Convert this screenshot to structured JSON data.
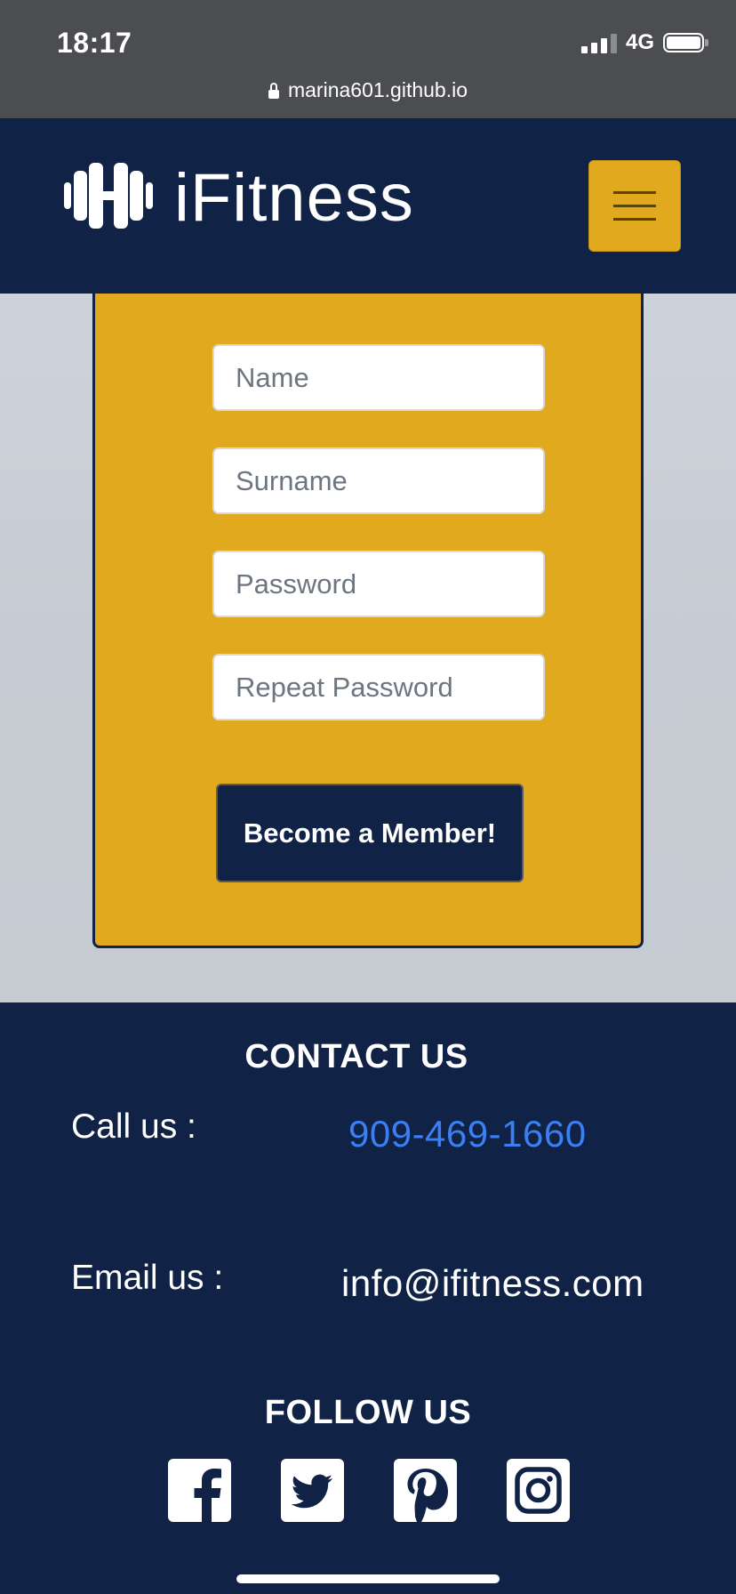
{
  "status_bar": {
    "time": "18:17",
    "network": "4G",
    "url": "marina601.github.io"
  },
  "header": {
    "brand": "iFitness",
    "logo_icon": "dumbbell-icon",
    "menu_icon": "hamburger-icon"
  },
  "form": {
    "fields": [
      {
        "placeholder": "Name",
        "type": "text"
      },
      {
        "placeholder": "Surname",
        "type": "text"
      },
      {
        "placeholder": "Password",
        "type": "password"
      },
      {
        "placeholder": "Repeat Password",
        "type": "password"
      }
    ],
    "submit_label": "Become a Member!"
  },
  "contact": {
    "title": "CONTACT US",
    "call_label": "Call us :",
    "phone": "909-469-1660",
    "email_label": "Email us :",
    "email": "info@ifitness.com"
  },
  "follow": {
    "title": "FOLLOW US",
    "icons": [
      "facebook-icon",
      "twitter-icon",
      "pinterest-icon",
      "instagram-icon"
    ]
  },
  "colors": {
    "navy": "#112247",
    "gold": "#e1a91e",
    "link_blue": "#3b7ff2"
  }
}
